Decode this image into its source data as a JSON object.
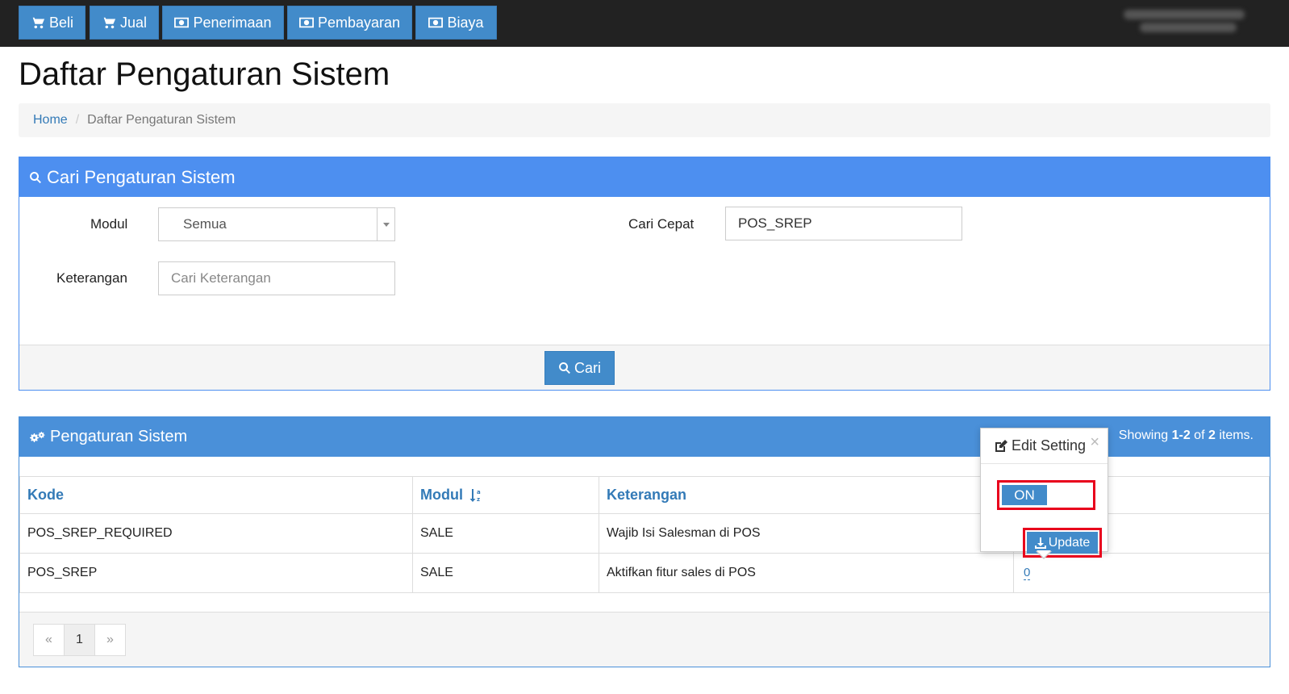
{
  "nav": {
    "items": [
      {
        "label": "Beli",
        "icon": "cart-icon"
      },
      {
        "label": "Jual",
        "icon": "cart-icon"
      },
      {
        "label": "Penerimaan",
        "icon": "money-icon"
      },
      {
        "label": "Pembayaran",
        "icon": "money-icon"
      },
      {
        "label": "Biaya",
        "icon": "money-icon"
      }
    ]
  },
  "page": {
    "title": "Daftar Pengaturan Sistem"
  },
  "breadcrumb": {
    "home": "Home",
    "current": "Daftar Pengaturan Sistem"
  },
  "search": {
    "title": "Cari Pengaturan Sistem",
    "modul_label": "Modul",
    "modul_value": "Semua",
    "cari_cepat_label": "Cari Cepat",
    "cari_cepat_value": "POS_SREP",
    "keterangan_label": "Keterangan",
    "keterangan_placeholder": "Cari Keterangan",
    "button_label": "Cari"
  },
  "results": {
    "title": "Pengaturan Sistem",
    "summary_prefix": "Showing ",
    "summary_range": "1-2",
    "summary_of": " of ",
    "summary_total": "2",
    "summary_suffix": " items.",
    "columns": {
      "kode": "Kode",
      "modul": "Modul",
      "keterangan": "Keterangan"
    },
    "rows": [
      {
        "kode": "POS_SREP_REQUIRED",
        "modul": "SALE",
        "keterangan": "Wajib Isi Salesman di POS",
        "nilai": ""
      },
      {
        "kode": "POS_SREP",
        "modul": "SALE",
        "keterangan": "Aktifkan fitur sales di POS",
        "nilai": "0"
      }
    ],
    "pager": {
      "prev": "«",
      "page": "1",
      "next": "»"
    }
  },
  "popover": {
    "title": "Edit Setting",
    "close": "×",
    "toggle_label": "ON",
    "update_label": "Update"
  },
  "colors": {
    "primary": "#428bca",
    "panel_header": "#4d8ff0",
    "highlight": "#e8001c",
    "topbar": "#222222"
  }
}
